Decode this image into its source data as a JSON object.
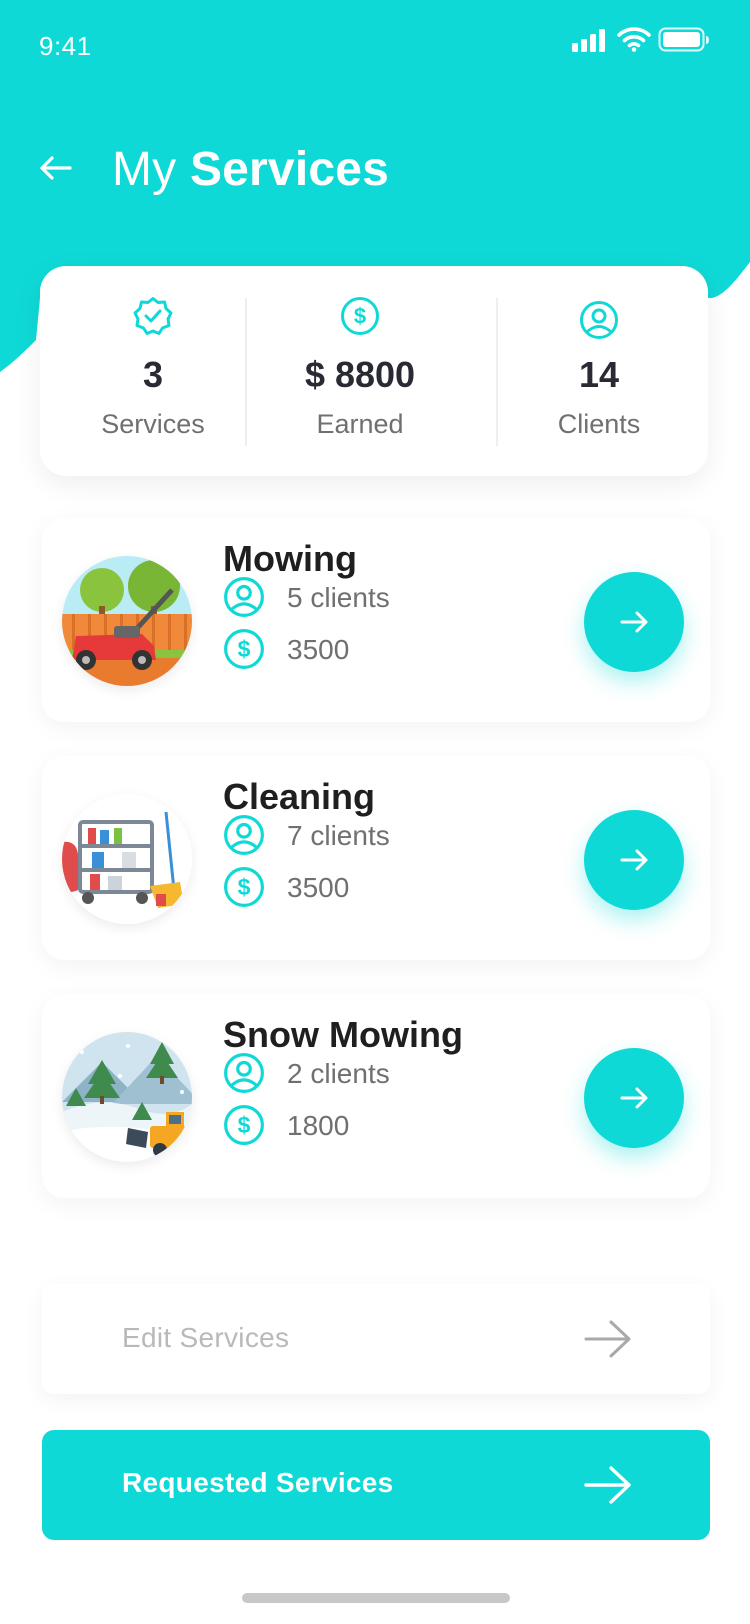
{
  "status_bar": {
    "time": "9:41"
  },
  "header": {
    "title_light": "My",
    "title_bold": "Services"
  },
  "stats": [
    {
      "icon": "verified-badge-icon",
      "value": "3",
      "label": "Services"
    },
    {
      "icon": "dollar-circle-icon",
      "value": "$ 8800",
      "label": "Earned"
    },
    {
      "icon": "user-circle-icon",
      "value": "14",
      "label": "Clients"
    }
  ],
  "services": [
    {
      "name": "Mowing",
      "clients": "5 clients",
      "earnings": "3500",
      "image": "lawn-mower-illustration"
    },
    {
      "name": "Cleaning",
      "clients": "7 clients",
      "earnings": "3500",
      "image": "cleaning-cart-illustration"
    },
    {
      "name": "Snow Mowing",
      "clients": "2 clients",
      "earnings": "1800",
      "image": "snow-plow-illustration"
    }
  ],
  "actions": {
    "edit_label": "Edit Services",
    "requested_label": "Requested Services"
  },
  "colors": {
    "accent": "#0fd9d6",
    "text_dark": "#1f1f1f",
    "text_muted": "#707070",
    "disabled_text": "#b9b9b9"
  }
}
